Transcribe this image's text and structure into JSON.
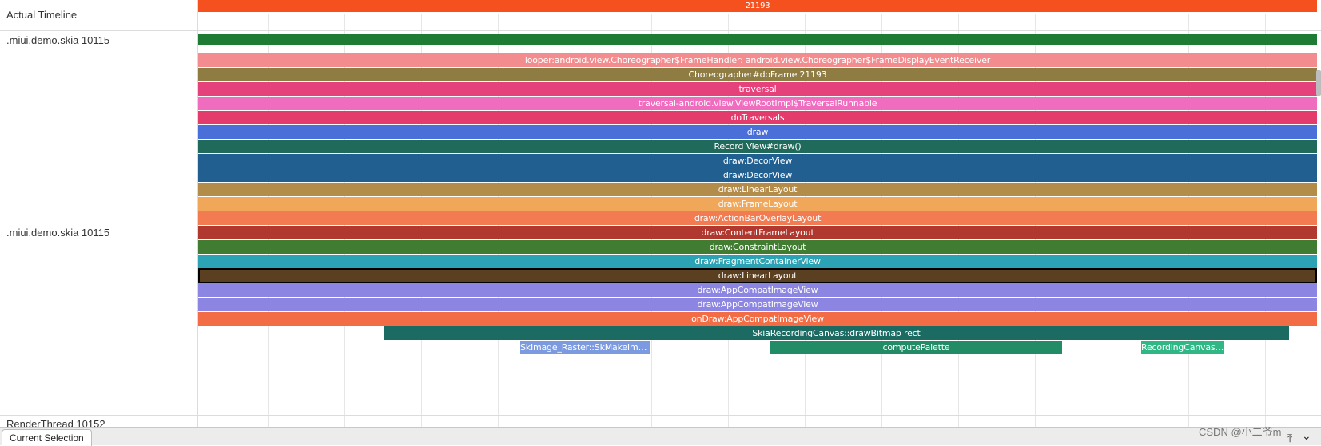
{
  "tracks": {
    "actual_timeline": "Actual Timeline",
    "main_thread_top": ".miui.demo.skia 10115",
    "main_thread": ".miui.demo.skia 10115",
    "render_thread": "RenderThread 10152"
  },
  "actual_timeline_slice": {
    "label": "21193",
    "color": "#f4511e"
  },
  "frame_bar": {
    "color": "#1e7b34"
  },
  "slices": [
    {
      "label": "looper:android.view.Choreographer$FrameHandler: android.view.Choreographer$FrameDisplayEventReceiver",
      "color": "#f28c8e"
    },
    {
      "label": "Choreographer#doFrame 21193",
      "color": "#8e7c43"
    },
    {
      "label": "traversal",
      "color": "#e5417a"
    },
    {
      "label": "traversal-android.view.ViewRootImpl$TraversalRunnable",
      "color": "#f06cbe"
    },
    {
      "label": "doTraversals",
      "color": "#e33c6c"
    },
    {
      "label": "draw",
      "color": "#4a6fd8"
    },
    {
      "label": "Record View#draw()",
      "color": "#1f6a5a"
    },
    {
      "label": "draw:DecorView",
      "color": "#215f91"
    },
    {
      "label": "draw:DecorView",
      "color": "#215f91"
    },
    {
      "label": "draw:LinearLayout",
      "color": "#b38c4a"
    },
    {
      "label": "draw:FrameLayout",
      "color": "#f1a759"
    },
    {
      "label": "draw:ActionBarOverlayLayout",
      "color": "#f27b51"
    },
    {
      "label": "draw:ContentFrameLayout",
      "color": "#b0382e"
    },
    {
      "label": "draw:ConstraintLayout",
      "color": "#417c33"
    },
    {
      "label": "draw:FragmentContainerView",
      "color": "#2ba3b4"
    },
    {
      "label": "draw:LinearLayout",
      "color": "#5a3f20"
    },
    {
      "label": "draw:AppCompatImageView",
      "color": "#8c85e2"
    },
    {
      "label": "draw:AppCompatImageView",
      "color": "#8c85e2"
    },
    {
      "label": "onDraw:AppCompatImageView",
      "color": "#f26c45"
    },
    {
      "label": "SkiaRecordingCanvas::drawBitmap rect",
      "color": "#1b6b63"
    },
    {
      "label": "SkImage_Raster::SkMakeImag...",
      "color": "#7c9ae0"
    },
    {
      "label": "computePalette",
      "color": "#228c66"
    },
    {
      "label": "RecordingCanvas::...",
      "color": "#2fb785"
    }
  ],
  "bottom_bar": {
    "tab_label": "Current Selection"
  },
  "watermark": "CSDN @小二爷m",
  "icons": {
    "pin": "pin-icon",
    "chevron": "chevron-down-icon"
  }
}
